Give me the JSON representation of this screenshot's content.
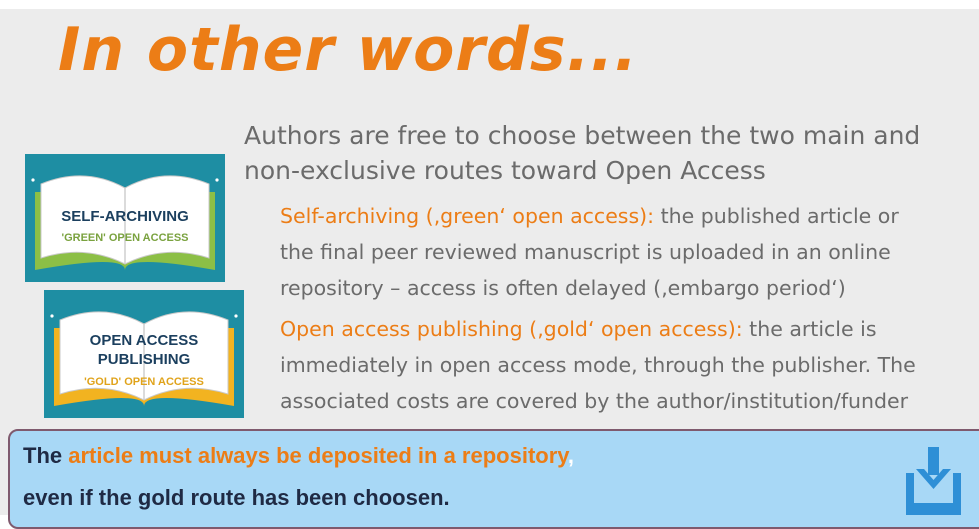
{
  "title": "In other words...",
  "intro": {
    "line1": "Authors are free to choose between the two main and",
    "line2": "non-exclusive routes toward Open Access"
  },
  "bullets": [
    {
      "lead": "Self-archiving (‚green‘ open access):",
      "line1_rest": " the published article or",
      "line2": "the final peer reviewed manuscript is uploaded in an online",
      "line3": "repository – access is often delayed (‚embargo period‘)"
    },
    {
      "lead": "Open access publishing (‚gold‘ open access):",
      "line1_rest": " the article is",
      "line2": "immediately in open access mode, through the publisher. The",
      "line3": "associated costs are covered by the author/institution/funder"
    }
  ],
  "badges": {
    "green": {
      "main1": "SELF-ARCHIVING",
      "sub": "'GREEN' OPEN ACCESS"
    },
    "gold": {
      "main1": "OPEN ACCESS",
      "main2": "PUBLISHING",
      "sub": "'GOLD' OPEN ACCESS"
    }
  },
  "callout": {
    "pre": "The ",
    "highlight": "article must always be deposited in a repository",
    "comma": ",",
    "line2": "even if the gold route has been choosen."
  },
  "icons": {
    "download": "download-tray-icon",
    "book": "open-book-icon"
  },
  "colors": {
    "title": "#ec7d16",
    "body_text": "#6b6b6b",
    "teal_frame": "#1e8ea3",
    "green_cover": "#8cbf46",
    "gold_cover": "#f2b320",
    "callout_bg": "#a8d8f6",
    "icon_blue": "#2e8fd6"
  }
}
